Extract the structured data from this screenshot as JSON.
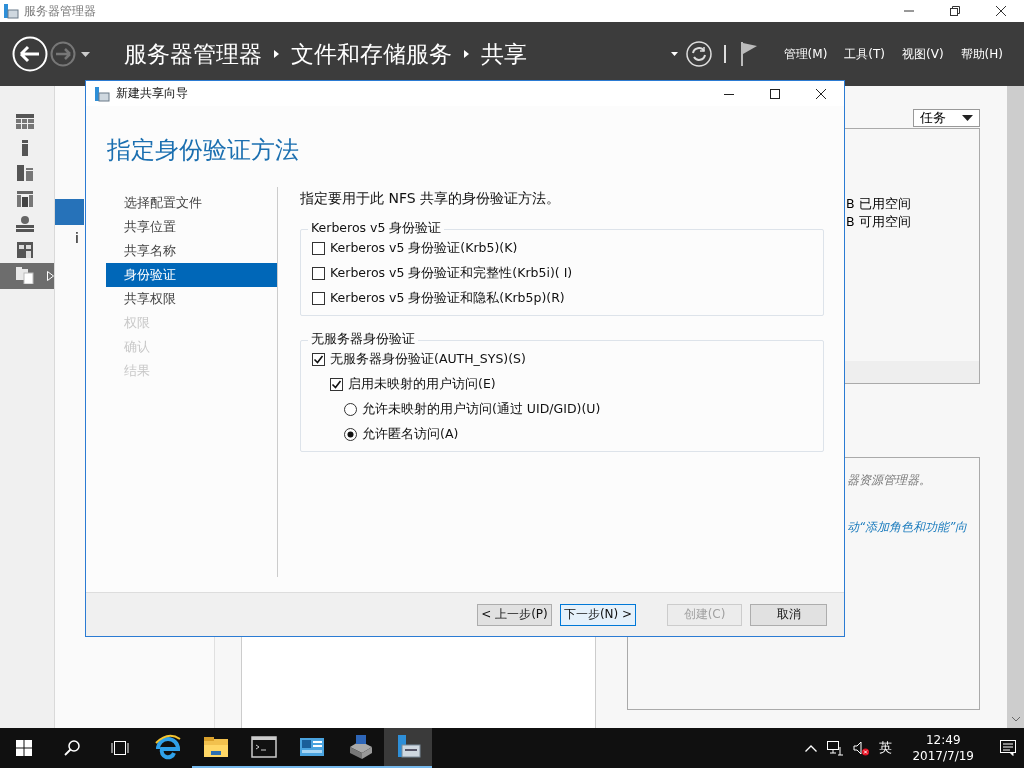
{
  "window": {
    "title": "服务器管理器"
  },
  "header": {
    "breadcrumbs": [
      "服务器管理器",
      "文件和存储服务",
      "共享"
    ],
    "menus": [
      "管理(M)",
      "工具(T)",
      "视图(V)",
      "帮助(H)"
    ]
  },
  "sidebar": {
    "items": [
      {
        "selected": false
      },
      {
        "selected": false
      },
      {
        "selected": false
      },
      {
        "selected": false
      },
      {
        "selected": false
      },
      {
        "selected": false
      },
      {
        "selected": true
      }
    ]
  },
  "nav": {
    "items": [
      {
        "selected": true
      },
      {
        "label": "i",
        "selected": false
      }
    ]
  },
  "content": {
    "tasks_button": "任务",
    "volume_lines": [
      "B 已用空间",
      "B 可用空间"
    ],
    "hint_lines": [
      {
        "kind": "note",
        "text": "器资源管理器。"
      },
      {
        "kind": "link",
        "text": "动“添加角色和功能”向"
      }
    ]
  },
  "dialog": {
    "title": "新建共享向导",
    "heading": "指定身份验证方法",
    "steps": [
      {
        "label": "选择配置文件",
        "selected": false,
        "disabled": false
      },
      {
        "label": "共享位置",
        "selected": false,
        "disabled": false
      },
      {
        "label": "共享名称",
        "selected": false,
        "disabled": false
      },
      {
        "label": "身份验证",
        "selected": true,
        "disabled": false
      },
      {
        "label": "共享权限",
        "selected": false,
        "disabled": false
      },
      {
        "label": "权限",
        "selected": false,
        "disabled": true
      },
      {
        "label": "确认",
        "selected": false,
        "disabled": true
      },
      {
        "label": "结果",
        "selected": false,
        "disabled": true
      }
    ],
    "description": "指定要用于此 NFS 共享的身份验证方法。",
    "groups": [
      {
        "title": "Kerberos v5 身份验证",
        "options": [
          {
            "kind": "checkbox",
            "label": "Kerberos v5 身份验证(Krb5)(K)",
            "checked": false
          },
          {
            "kind": "checkbox",
            "label": "Kerberos v5 身份验证和完整性(Krb5i)( I)",
            "checked": false
          },
          {
            "kind": "checkbox",
            "label": "Kerberos v5 身份验证和隐私(Krb5p)(R)",
            "checked": false
          }
        ]
      },
      {
        "title": "无服务器身份验证",
        "options": [
          {
            "kind": "checkbox",
            "label": "无服务器身份验证(AUTH_SYS)(S)",
            "checked": true,
            "children": [
              {
                "kind": "checkbox",
                "label": "启用未映射的用户访问(E)",
                "checked": true,
                "children": [
                  {
                    "kind": "radio",
                    "label": "允许未映射的用户访问(通过 UID/GID)(U)",
                    "selected": false
                  },
                  {
                    "kind": "radio",
                    "label": "允许匿名访问(A)",
                    "selected": true
                  }
                ]
              }
            ]
          }
        ]
      }
    ],
    "buttons": [
      {
        "label": "< 上一步(P)",
        "disabled": false,
        "focused": false
      },
      {
        "label": "下一步(N) >",
        "disabled": false,
        "focused": true
      },
      {
        "label": "创建(C)",
        "disabled": true,
        "focused": false
      },
      {
        "label": "取消",
        "disabled": false,
        "focused": false
      }
    ]
  },
  "taskbar": {
    "apps": [
      {
        "running": false,
        "active": false
      },
      {
        "running": true,
        "active": false
      },
      {
        "running": true,
        "active": false
      },
      {
        "running": true,
        "active": false
      },
      {
        "running": true,
        "active": false
      },
      {
        "running": true,
        "active": true
      }
    ],
    "ime": "英",
    "time": "12:49",
    "date": "2017/7/19"
  }
}
